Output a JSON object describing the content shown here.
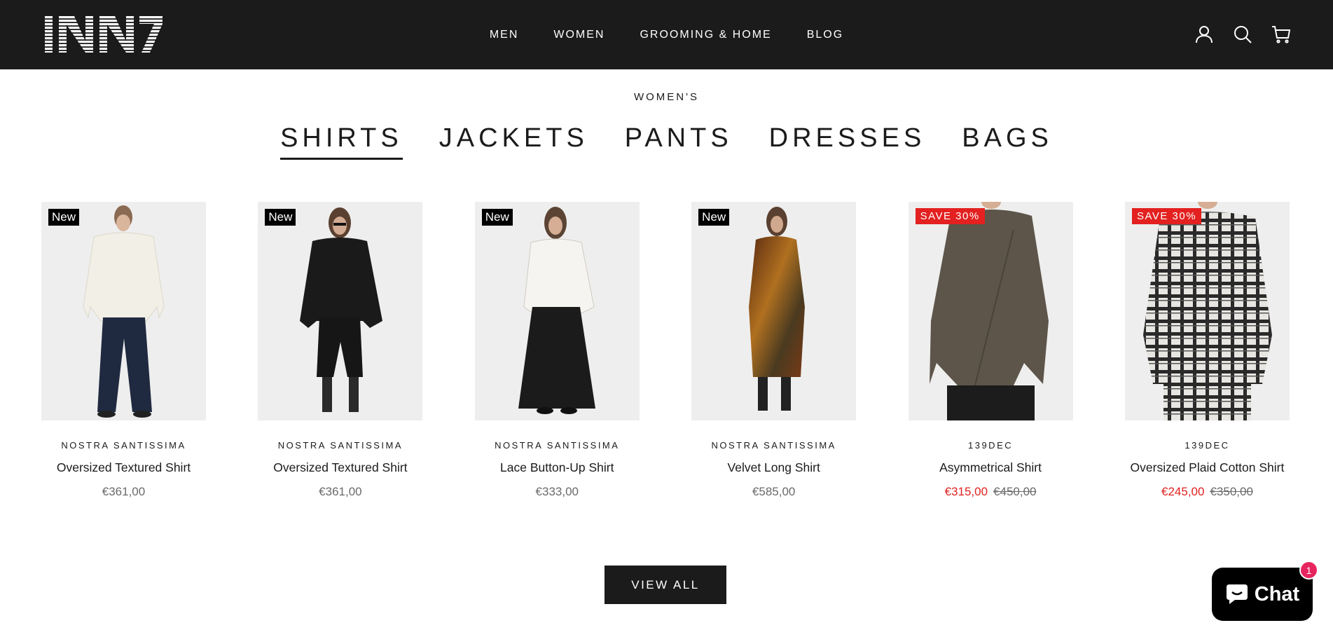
{
  "header": {
    "logo": "INN7",
    "nav": [
      "MEN",
      "WOMEN",
      "GROOMING & HOME",
      "BLOG"
    ],
    "icons": [
      "account-icon",
      "search-icon",
      "cart-icon"
    ]
  },
  "section": {
    "eyebrow": "WOMEN'S",
    "tabs": [
      "SHIRTS",
      "JACKETS",
      "PANTS",
      "DRESSES",
      "BAGS"
    ],
    "active_tab": "SHIRTS"
  },
  "products": [
    {
      "badge": "New",
      "brand": "NOSTRA SANTISSIMA",
      "name": "Oversized Textured Shirt",
      "price": "€361,00",
      "compare_price": ""
    },
    {
      "badge": "New",
      "brand": "NOSTRA SANTISSIMA",
      "name": "Oversized Textured Shirt",
      "price": "€361,00",
      "compare_price": ""
    },
    {
      "badge": "New",
      "brand": "NOSTRA SANTISSIMA",
      "name": "Lace Button-Up Shirt",
      "price": "€333,00",
      "compare_price": ""
    },
    {
      "badge": "New",
      "brand": "NOSTRA SANTISSIMA",
      "name": "Velvet Long Shirt",
      "price": "€585,00",
      "compare_price": ""
    },
    {
      "badge": "SAVE 30%",
      "brand": "139DEC",
      "name": "Asymmetrical Shirt",
      "price": "€315,00",
      "compare_price": "€450,00"
    },
    {
      "badge": "SAVE 30%",
      "brand": "139DEC",
      "name": "Oversized Plaid Cotton Shirt",
      "price": "€245,00",
      "compare_price": "€350,00"
    }
  ],
  "view_all_label": "VIEW ALL",
  "chat": {
    "label": "Chat",
    "count": "1"
  },
  "colors": {
    "header_bg": "#1c1b1b",
    "sale": "#e22120",
    "chat_badge": "#e8245e"
  }
}
